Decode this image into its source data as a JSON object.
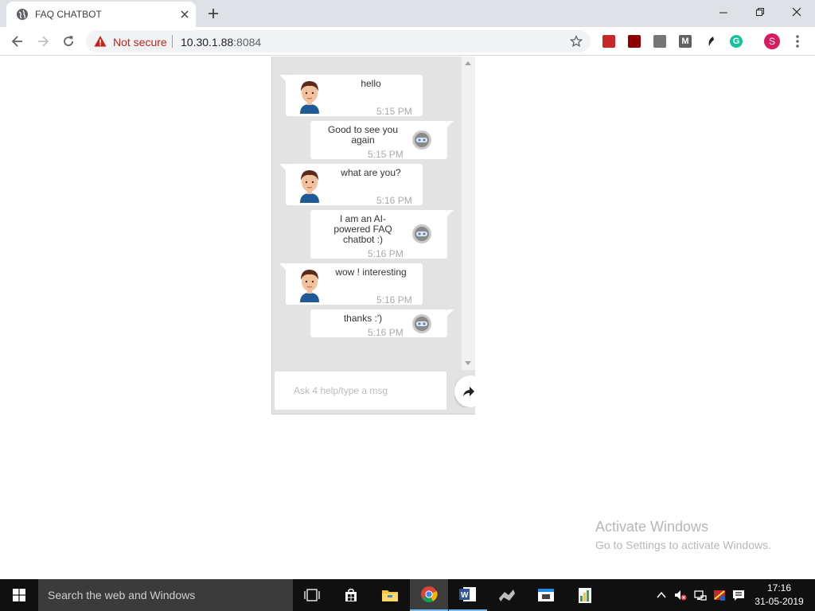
{
  "browser": {
    "tab_title": "FAQ CHATBOT",
    "security_label": "Not secure",
    "url_host": "10.30.1.88",
    "url_port": ":8084",
    "profile_initial": "S"
  },
  "chat": {
    "messages": [
      {
        "sender": "user",
        "text": "hello",
        "time": "5:15 PM"
      },
      {
        "sender": "bot",
        "text": "Good to see you again",
        "time": "5:15 PM"
      },
      {
        "sender": "user",
        "text": "what are you?",
        "time": "5:16 PM"
      },
      {
        "sender": "bot",
        "text": "I am an AI-powered FAQ chatbot :)",
        "time": "5:16 PM"
      },
      {
        "sender": "user",
        "text": "wow ! interesting",
        "time": "5:16 PM"
      },
      {
        "sender": "bot",
        "text": "thanks :')",
        "time": "5:16 PM"
      }
    ],
    "input_placeholder": "Ask 4 help/type a msg"
  },
  "watermark": {
    "title": "Activate Windows",
    "subtitle": "Go to Settings to activate Windows."
  },
  "taskbar": {
    "search_placeholder": "Search the web and Windows",
    "clock_time": "17:16",
    "clock_date": "31-05-2019"
  }
}
